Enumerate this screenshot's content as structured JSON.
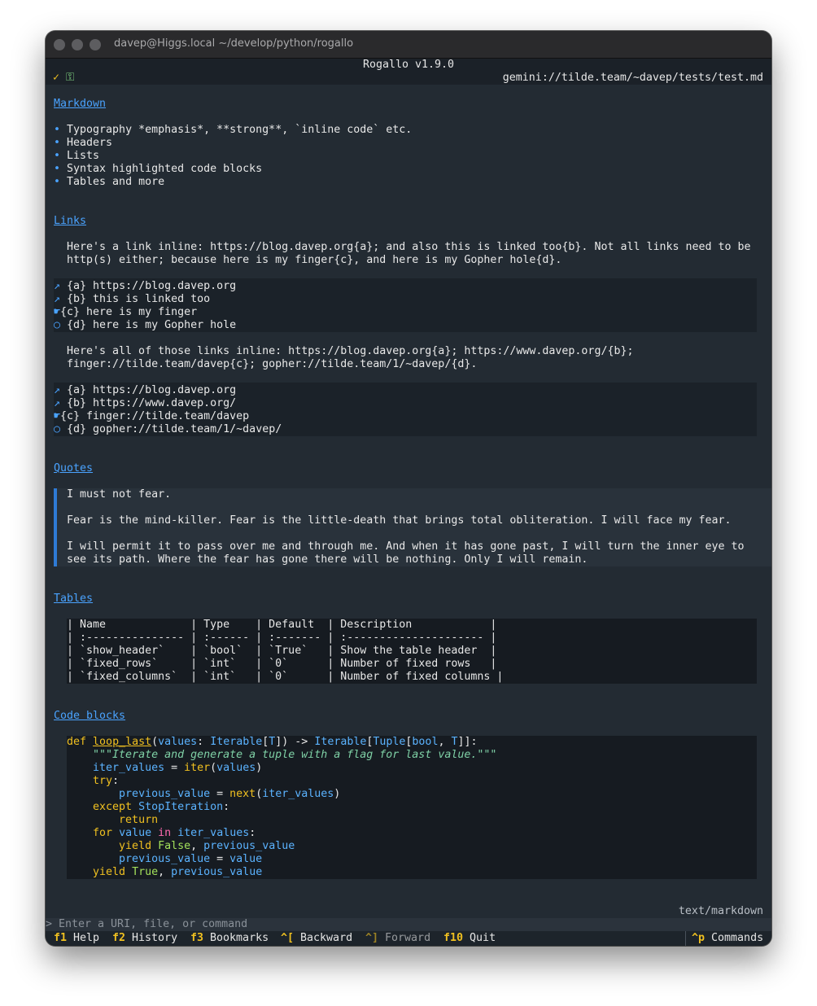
{
  "window": {
    "title": "davep@Higgs.local ~/develop/python/rogallo"
  },
  "app": {
    "title": "Rogallo v1.9.0",
    "status_check": "✓",
    "status_lock": "⚿",
    "address": "gemini://tilde.team/~davep/tests/test.md"
  },
  "sections": {
    "markdown": {
      "heading": "Markdown",
      "bullets": [
        "Typography *emphasis*, **strong**, `inline code` etc.",
        "Headers",
        "Lists",
        "Syntax highlighted code blocks",
        "Tables and more"
      ]
    },
    "links": {
      "heading": "Links",
      "para1": [
        "Here's a link inline: https://blog.davep.org{a}; and also this is linked too{b}. Not all links need to be",
        "http(s) either; because here is my finger{c}, and here is my Gopher hole{d}."
      ],
      "list1": [
        {
          "icon": "↗",
          "text": "{a} https://blog.davep.org"
        },
        {
          "icon": "↗",
          "text": "{b} this is linked too"
        },
        {
          "icon": "☛",
          "text": "{c} here is my finger"
        },
        {
          "icon": "○",
          "text": "{d} here is my Gopher hole"
        }
      ],
      "para2": [
        "Here's all of those links inline: https://blog.davep.org{a}; https://www.davep.org/{b};",
        "finger://tilde.team/davep{c}; gopher://tilde.team/1/~davep/{d}."
      ],
      "list2": [
        {
          "icon": "↗",
          "text": "{a} https://blog.davep.org"
        },
        {
          "icon": "↗",
          "text": "{b} https://www.davep.org/"
        },
        {
          "icon": "☛",
          "text": "{c} finger://tilde.team/davep"
        },
        {
          "icon": "○",
          "text": "{d} gopher://tilde.team/1/~davep/"
        }
      ]
    },
    "quotes": {
      "heading": "Quotes",
      "lines": [
        "I must not fear.",
        "Fear is the mind-killer. Fear is the little-death that brings total obliteration. I will face my fear.",
        "I will permit it to pass over me and through me. And when it has gone past, I will turn the inner eye to",
        "see its path. Where the fear has gone there will be nothing. Only I will remain."
      ]
    },
    "tables": {
      "heading": "Tables",
      "rows": [
        "| Name             | Type    | Default  | Description            |",
        "| :--------------- | :------ | :------- | :--------------------- |",
        "| `show_header`    | `bool`  | `True`   | Show the table header  |",
        "| `fixed_rows`     | `int`   | `0`      | Number of fixed rows   |",
        "| `fixed_columns`  | `int`   | `0`      | Number of fixed columns |"
      ]
    },
    "code": {
      "heading": "Code blocks",
      "tokens": {
        "def": "def",
        "loop_last": "loop_last",
        "p1": "(",
        "values": "values",
        "colon_sp": ": ",
        "Iterable": "Iterable",
        "lb": "[",
        "T": "T",
        "rb": "]",
        "arrow": ") -> ",
        "Tuple": "Tuple",
        "bool": "bool",
        "comma_sp": ", ",
        "end1": "]]:",
        "docstring": "\"\"\"Iterate and generate a tuple with a flag for last value.\"\"\"",
        "iter_values": "iter_values",
        "eq": " = ",
        "iter": "iter",
        "p_open": "(",
        "p_close": ")",
        "try": "try",
        "colon": ":",
        "previous_value": "previous_value",
        "next": "next",
        "except": "except",
        "StopIteration": "StopIteration",
        "return": "return",
        "for": "for",
        "value": "value",
        "in": "in",
        "yield": "yield",
        "False": "False",
        "True": "True",
        "sp": " "
      }
    }
  },
  "footer": {
    "mime": "text/markdown",
    "input_placeholder": "> Enter a URI, file, or command",
    "keys": [
      {
        "key": "f1",
        "label": "Help"
      },
      {
        "key": "f2",
        "label": "History"
      },
      {
        "key": "f3",
        "label": "Bookmarks"
      },
      {
        "key": "^[",
        "label": "Backward"
      },
      {
        "key": "^]",
        "label": "Forward"
      },
      {
        "key": "f10",
        "label": "Quit"
      },
      {
        "key": "^p",
        "label": "Commands"
      }
    ]
  },
  "colors": {
    "accent": "#4aa3ff",
    "key": "#f0c020",
    "background": "#232b33"
  }
}
